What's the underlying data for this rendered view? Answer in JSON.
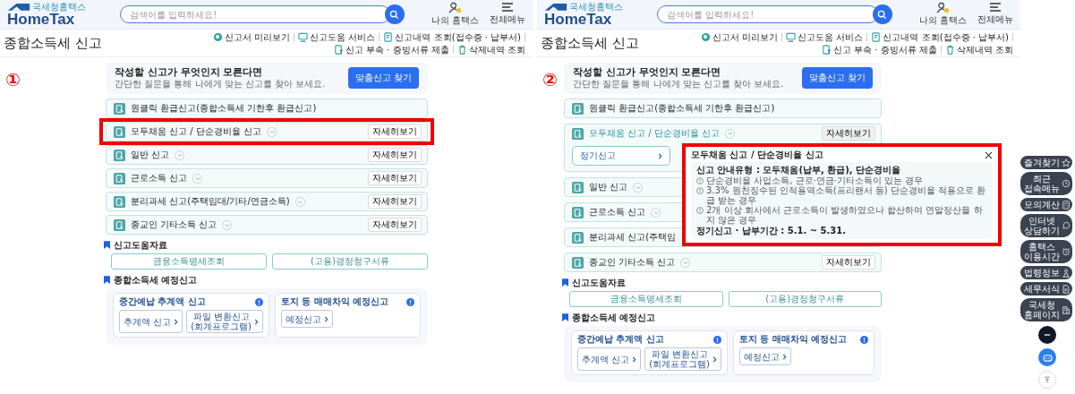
{
  "panels": [
    {
      "marker": "①",
      "header": {
        "logo_caption": "국세청홈택스",
        "logo": "HomeTax",
        "search": {
          "placeholder": "검색어를 입력하세요!"
        },
        "actions": [
          {
            "label": "나의 홈택스",
            "kind": "user"
          },
          {
            "label": "전체메뉴",
            "kind": "menu"
          }
        ]
      },
      "page_title": "종합소득세 신고",
      "toolbar": [
        {
          "label": "신고서 미리보기",
          "kind": "preview"
        },
        {
          "label": "신고도움 서비스",
          "kind": "help"
        },
        {
          "label": "신고내역 조회(접수증 · 납부서)",
          "kind": "history"
        },
        {
          "label": "신고 부속 · 증빙서류 제출",
          "kind": "upload"
        },
        {
          "label": "삭제내역 조회",
          "kind": "trash"
        }
      ],
      "intro": {
        "title": "작성할 신고가 무엇인지 모른다면",
        "text": "간단한 질문을 통해 나에게 맞는 신고를 찾아 보세요.",
        "button": "맞춤신고 찾기"
      },
      "filings": [
        {
          "label": "원클릭 환급신고(종합소득세 기한후 환급신고)",
          "kind": "link",
          "highlighted": false
        },
        {
          "label": "모두채움 신고 / 단순경비율 신고",
          "kind": "expandable",
          "expanded": false,
          "detail": "자세히보기",
          "highlighted": true
        },
        {
          "label": "일반 신고",
          "kind": "expandable",
          "expanded": false,
          "detail": "자세히보기",
          "highlighted": false
        },
        {
          "label": "근로소득 신고",
          "kind": "expandable",
          "expanded": false,
          "detail": "자세히보기",
          "highlighted": false
        },
        {
          "label": "분리과세 신고(주택임대/기타/연금소득)",
          "kind": "expandable",
          "expanded": false,
          "detail": "자세히보기",
          "highlighted": false
        },
        {
          "label": "종교인 기타소득 신고",
          "kind": "expandable",
          "expanded": false,
          "detail": "자세히보기",
          "highlighted": false
        }
      ],
      "help_materials": {
        "title": "신고도움자료",
        "buttons": [
          "금융소득명세조회",
          "(고용)경정청구서류"
        ]
      },
      "estimate": {
        "title": "종합소득세 예정신고",
        "cards": [
          {
            "title": "중간예납 추계액 신고",
            "buttons": [
              {
                "lines": [
                  "추계액 신고"
                ]
              },
              {
                "lines": [
                  "파일 변환신고",
                  "(회계프로그램)"
                ]
              }
            ]
          },
          {
            "title": "토지 등 매매차익 예정신고",
            "buttons": [
              {
                "lines": [
                  "예정신고"
                ]
              }
            ]
          }
        ]
      }
    },
    {
      "marker": "②",
      "header": {
        "logo_caption": "국세청홈택스",
        "logo": "HomeTax",
        "search": {
          "placeholder": "검색어를 입력하세요!"
        },
        "actions": [
          {
            "label": "나의 홈택스",
            "kind": "user"
          },
          {
            "label": "전체메뉴",
            "kind": "menu"
          }
        ]
      },
      "page_title": "종합소득세 신고",
      "toolbar": [
        {
          "label": "신고서 미리보기",
          "kind": "preview"
        },
        {
          "label": "신고도움 서비스",
          "kind": "help"
        },
        {
          "label": "신고내역 조회(접수증 · 납부서)",
          "kind": "history"
        },
        {
          "label": "신고 부속 · 증빙서류 제출",
          "kind": "upload"
        },
        {
          "label": "삭제내역 조회",
          "kind": "trash"
        }
      ],
      "intro": {
        "title": "작성할 신고가 무엇인지 모른다면",
        "text": "간단한 질문을 통해 나에게 맞는 신고를 찾아 보세요.",
        "button": "맞춤신고 찾기"
      },
      "filings": [
        {
          "label": "원클릭 환급신고(종합소득세 기한후 환급신고)",
          "kind": "link",
          "highlighted": false
        },
        {
          "label": "모두채움 신고 / 단순경비율 신고",
          "kind": "expandable",
          "expanded": true,
          "detail": "자세히보기",
          "highlighted": false,
          "actions": [
            "정기신고"
          ]
        },
        {
          "label": "일반 신고",
          "kind": "expandable",
          "expanded": false,
          "highlighted": false
        },
        {
          "label": "근로소득 신고",
          "kind": "expandable",
          "expanded": false,
          "highlighted": false
        },
        {
          "label": "분리과세 신고(주택임",
          "kind": "link",
          "highlighted": false
        },
        {
          "label": "종교인 기타소득 신고",
          "kind": "expandable",
          "expanded": false,
          "detail": "자세히보기",
          "highlighted": false
        }
      ],
      "popup": {
        "title": "모두채움 신고 / 단순경비율 신고",
        "highlighted": true,
        "heading": "신고 안내유형 : 모두채움(납부, 환급), 단순경비율",
        "items": [
          "단순경비율 사업소득, 근로·연금·기타소득이 있는 경우",
          "3.3% 원천징수된 인적용역소득(프리랜서 등) 단순경비율 적용으로 환급 받는 경우",
          "2개 이상 회사에서 근로소득이 발생하였으나 합산하여 연말정산을 하지 않은 경우"
        ],
        "period": "정기신고 · 납부기간 : 5.1. ~ 5.31."
      },
      "help_materials": {
        "title": "신고도움자료",
        "buttons": [
          "금융소득명세조회",
          "(고용)경정청구서류"
        ]
      },
      "estimate": {
        "title": "종합소득세 예정신고",
        "cards": [
          {
            "title": "중간예납 추계액 신고",
            "buttons": [
              {
                "lines": [
                  "추계액 신고"
                ]
              },
              {
                "lines": [
                  "파일 변환신고",
                  "(회계프로그램)"
                ]
              }
            ]
          },
          {
            "title": "토지 등 매매차익 예정신고",
            "buttons": [
              {
                "lines": [
                  "예정신고"
                ]
              }
            ]
          }
        ]
      }
    }
  ],
  "quick_menu": [
    {
      "lines": [
        "즐겨찾기"
      ],
      "kind": "star"
    },
    {
      "lines": [
        "최근",
        "접속메뉴"
      ],
      "kind": "clock"
    },
    {
      "lines": [
        "모의계산"
      ],
      "kind": "calc"
    },
    {
      "lines": [
        "인터넷",
        "상담하기"
      ],
      "kind": "chat"
    },
    {
      "lines": [
        "홈택스",
        "이용시간"
      ],
      "kind": "alarm"
    },
    {
      "lines": [
        "법령정보"
      ],
      "kind": "law"
    },
    {
      "lines": [
        "세무서식"
      ],
      "kind": "doc"
    },
    {
      "lines": [
        "국세청",
        "홈페이지"
      ],
      "kind": "building"
    }
  ]
}
